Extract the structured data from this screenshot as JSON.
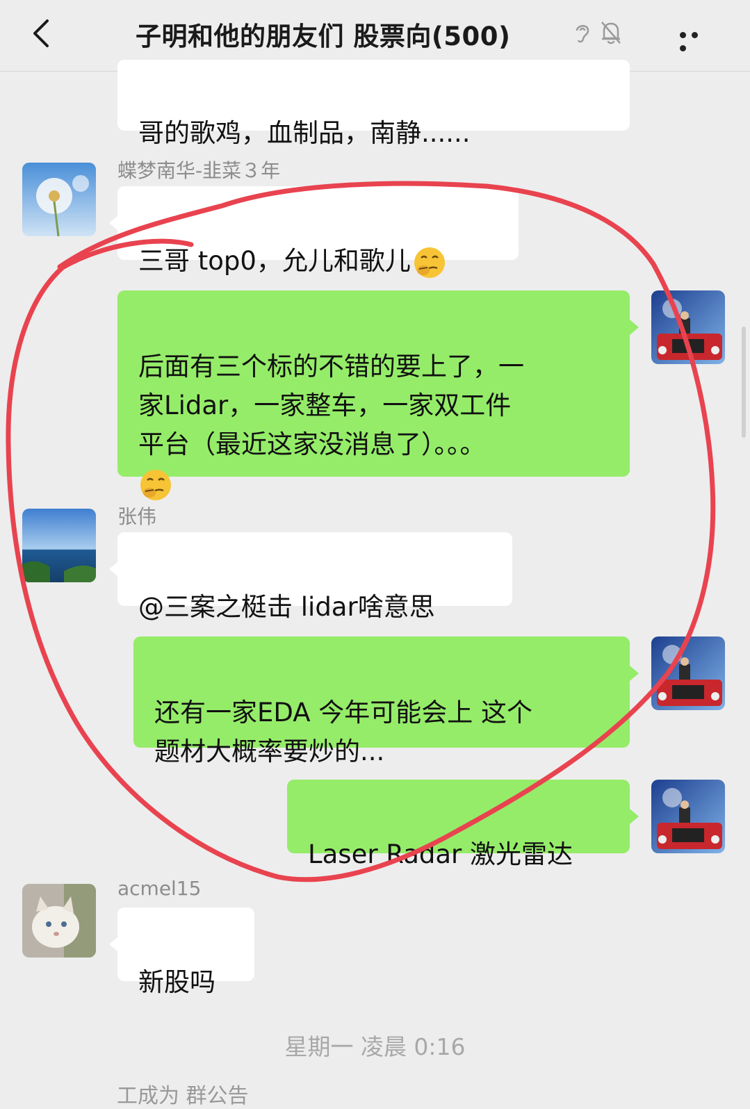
{
  "header": {
    "title": "子明和他的朋友们 股票向(500)"
  },
  "messages": [
    {
      "text": "哥的歌鸡，血制品，南静......"
    },
    {
      "sender": "蝶梦南华-韭菜３年",
      "text": "三哥 top0，允儿和歌儿"
    },
    {
      "text": "后面有三个标的不错的要上了，一\n家Lidar，一家整车，一家双工件\n平台（最近这家没消息了）。。。"
    },
    {
      "sender": "张伟",
      "text": "@三案之梃击 lidar啥意思"
    },
    {
      "text": "还有一家EDA 今年可能会上 这个\n题材大概率要炒的..."
    },
    {
      "text": "Laser Radar 激光雷达"
    },
    {
      "sender": "acmel15",
      "text": "新股吗"
    }
  ],
  "timestamp": "星期一 凌晨 0:16",
  "system_partial": "工成为 群公告",
  "colors": {
    "bubble_out": "#95ec69",
    "bubble_in": "#ffffff",
    "annotation": "#e8434f"
  }
}
